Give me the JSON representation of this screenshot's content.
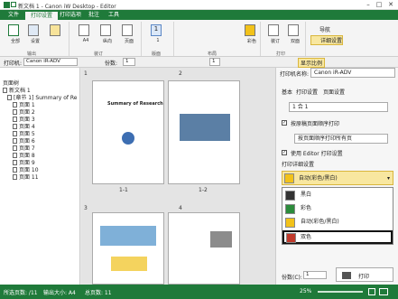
{
  "window": {
    "title": "新文档 1 - Canon iW Desktop - Editor"
  },
  "menu": {
    "tabs": [
      "文件",
      "打印设置",
      "打印选项",
      "批注",
      "工具"
    ],
    "active": 1
  },
  "ribbon": {
    "groups": [
      "输出",
      "装订",
      "版面",
      "布局",
      "纸张",
      "打印"
    ],
    "buttons": [
      "全部",
      "设置",
      "A4",
      "纵向",
      "页面",
      "1",
      "彩色",
      "装订",
      "双面"
    ],
    "options": [
      "导航",
      "详细设置"
    ]
  },
  "toolbar": {
    "printer_label": "打印机:",
    "printer": "Canon iR-ADV",
    "copies_label": "份数:",
    "copies": "1",
    "page": "1",
    "zoom_label": "显示比例"
  },
  "tree": {
    "header": "页面树",
    "items": [
      "新文档 1",
      "[章节 1] Summary of Re",
      "页面 1",
      "页面 2",
      "页面 3",
      "页面 4",
      "页面 5",
      "页面 6",
      "页面 7",
      "页面 8",
      "页面 9",
      "页面 10",
      "页面 11"
    ]
  },
  "center": {
    "pages": [
      "1",
      "2",
      "3",
      "4"
    ],
    "labels": [
      "1-1",
      "1-2"
    ],
    "doc_title": "Summary of Research"
  },
  "right": {
    "printer_label": "打印机名称:",
    "printer": "Canon iR-ADV",
    "tabs": [
      "基本",
      "打印设置",
      "页面设置"
    ],
    "row1": "1 合 1",
    "chk1": "按原稿页面顺序打印",
    "sel1": "按页面顺序打印所有页",
    "chk2": "使用 Editor 打印设置",
    "sec_label": "打印详细设置",
    "color_sel": "自动(彩色/黑白)",
    "options": [
      "黑白",
      "彩色",
      "自动(彩色/黑白)",
      "双色"
    ],
    "copies_label": "份数(C):",
    "copies": "1",
    "print_btn": "打印"
  },
  "status": {
    "text1": "所选页数: /11",
    "text2": "输出大小: A4",
    "text3": "总页数: 11",
    "zoom": "25%"
  }
}
